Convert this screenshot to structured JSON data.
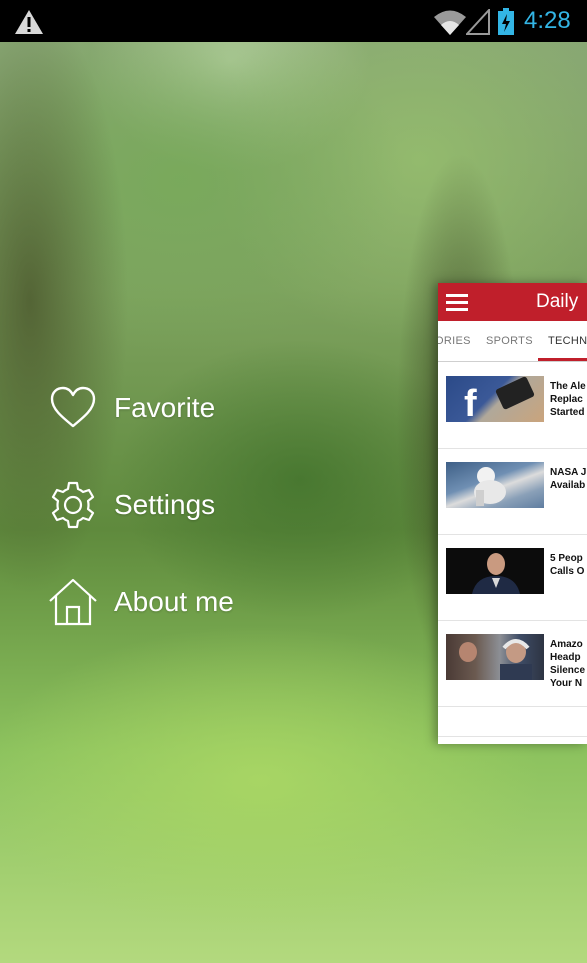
{
  "status_bar": {
    "time": "4:28",
    "icons": [
      "warning-icon",
      "wifi-icon",
      "signal-icon",
      "battery-charging-icon"
    ],
    "accent_color": "#33b5e5"
  },
  "drawer_menu": {
    "items": [
      {
        "label": "Favorite",
        "icon": "heart-icon"
      },
      {
        "label": "Settings",
        "icon": "gear-icon"
      },
      {
        "label": "About me",
        "icon": "home-icon"
      }
    ]
  },
  "app_preview": {
    "toolbar": {
      "title": "Daily",
      "menu_icon": "hamburger-icon",
      "color": "#c01f2b"
    },
    "tabs": [
      {
        "label": "ORIES"
      },
      {
        "label": "SPORTS"
      },
      {
        "label": "TECHN",
        "active": true
      }
    ],
    "articles": [
      {
        "headline": "The Ale\nReplac\nStarted"
      },
      {
        "headline": "NASA J\nAvailab"
      },
      {
        "headline": "5 Peop\nCalls O"
      },
      {
        "headline": "Amazo\nHeadp\nSilence\nYour N"
      }
    ]
  }
}
